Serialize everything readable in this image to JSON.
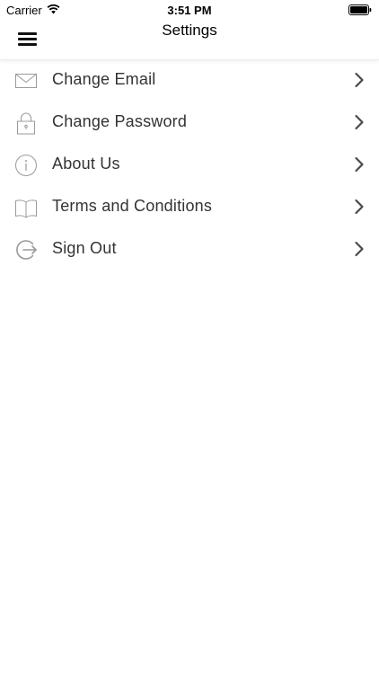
{
  "status_bar": {
    "carrier": "Carrier",
    "time": "3:51 PM"
  },
  "nav": {
    "title": "Settings",
    "menu_icon": "hamburger-icon"
  },
  "menu": [
    {
      "label": "Change Email",
      "icon": "envelope-icon"
    },
    {
      "label": "Change Password",
      "icon": "lock-icon"
    },
    {
      "label": "About Us",
      "icon": "info-icon"
    },
    {
      "label": "Terms and Conditions",
      "icon": "book-icon"
    },
    {
      "label": "Sign Out",
      "icon": "sign-out-icon"
    }
  ],
  "colors": {
    "icon": "#9a9a9a",
    "chevron": "#4a4a4a",
    "label": "#333333"
  }
}
